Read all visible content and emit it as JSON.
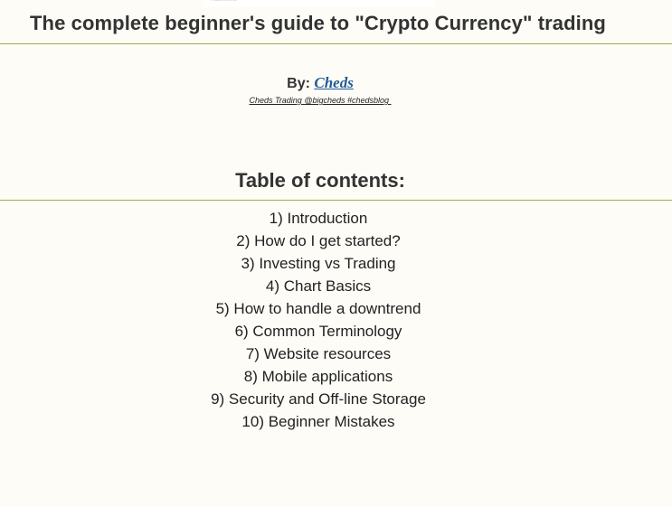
{
  "colors": {
    "background": "#fdfcf7",
    "divider": "#a9ab4a",
    "link": "#1f5a96",
    "text": "#333333"
  },
  "top_strip": {
    "text": "Tradesmns"
  },
  "header": {
    "title": "The complete beginner's guide to \"Crypto Currency\" trading"
  },
  "byline": {
    "prefix": "By: ",
    "author": "Cheds",
    "subline": "Cheds Trading @bigcheds #chedsblog "
  },
  "toc": {
    "heading": "Table of contents:",
    "items": [
      {
        "label": "1) Introduction"
      },
      {
        "label": "2) How do I get started?"
      },
      {
        "label": "3) Investing vs Trading"
      },
      {
        "label": "4) Chart Basics"
      },
      {
        "label": "5) How to handle a downtrend"
      },
      {
        "label": "6) Common Terminology"
      },
      {
        "label": "7) Website resources"
      },
      {
        "label": "8) Mobile applications"
      },
      {
        "label": "9) Security and Off-line Storage"
      },
      {
        "label": "10) Beginner Mistakes"
      }
    ]
  }
}
